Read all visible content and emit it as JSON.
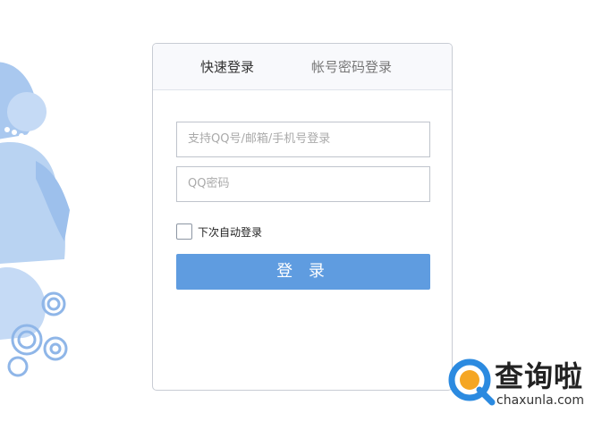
{
  "login": {
    "tabs": {
      "quick": "快速登录",
      "account": "帐号密码登录"
    },
    "account_input": {
      "placeholder": "支持QQ号/邮箱/手机号登录"
    },
    "password_input": {
      "placeholder": "QQ密码"
    },
    "remember_label": "下次自动登录",
    "login_button": "登 录"
  },
  "watermark": {
    "site_name": "查询啦",
    "domain": "chaxunla.com"
  },
  "colors": {
    "accent": "#5f9ce0",
    "decoration": "#a9c8ef",
    "watermark_logo_orange": "#f5a623",
    "watermark_logo_blue": "#2b8ae0"
  }
}
